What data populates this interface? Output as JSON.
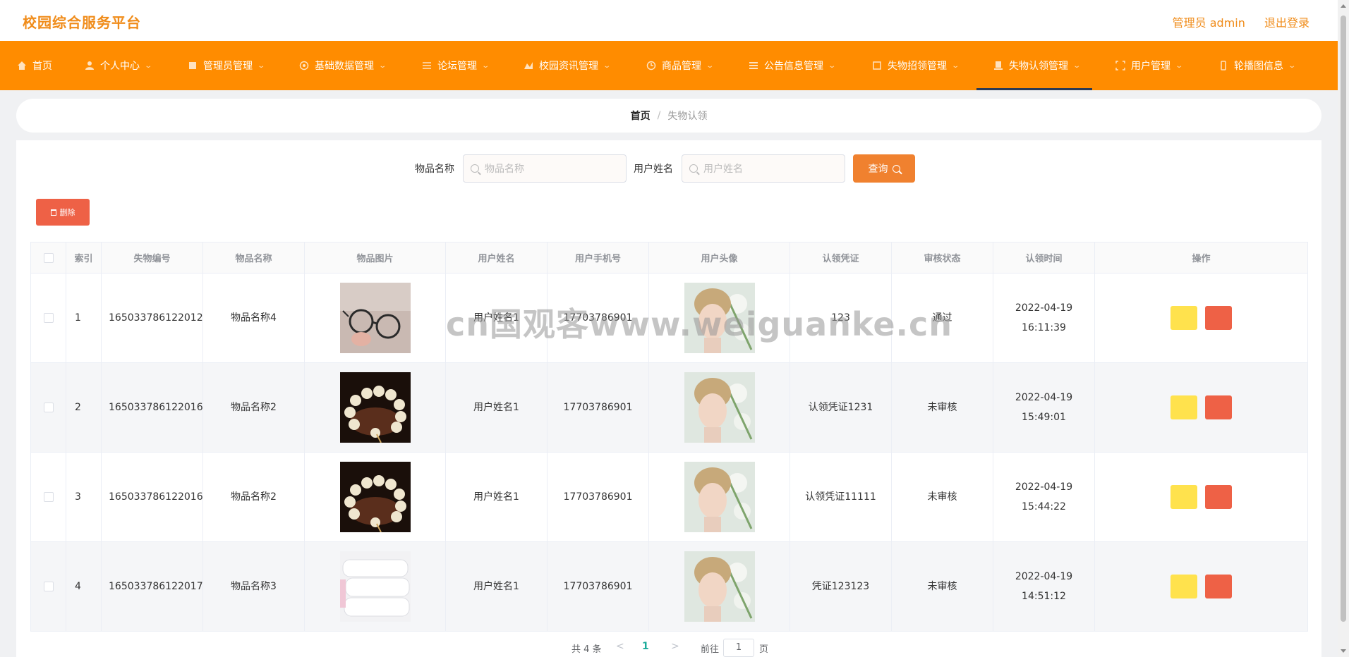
{
  "header": {
    "brand": "校园综合服务平台",
    "admin_label": "管理员 admin",
    "logout_label": "退出登录"
  },
  "nav": {
    "items": [
      {
        "label": "首页",
        "icon": "home-icon",
        "has_menu": false
      },
      {
        "label": "个人中心",
        "icon": "user-icon",
        "has_menu": true
      },
      {
        "label": "管理员管理",
        "icon": "admin-icon",
        "has_menu": true
      },
      {
        "label": "基础数据管理",
        "icon": "data-icon",
        "has_menu": true
      },
      {
        "label": "论坛管理",
        "icon": "forum-icon",
        "has_menu": true
      },
      {
        "label": "校园资讯管理",
        "icon": "news-icon",
        "has_menu": true
      },
      {
        "label": "商品管理",
        "icon": "goods-icon",
        "has_menu": true
      },
      {
        "label": "公告信息管理",
        "icon": "notice-icon",
        "has_menu": true
      },
      {
        "label": "失物招领管理",
        "icon": "lost-found-icon",
        "has_menu": true
      },
      {
        "label": "失物认领管理",
        "icon": "claim-icon",
        "has_menu": true,
        "active": true
      },
      {
        "label": "用户管理",
        "icon": "users-icon",
        "has_menu": true
      },
      {
        "label": "轮播图信息",
        "icon": "carousel-icon",
        "has_menu": true
      }
    ]
  },
  "breadcrumb": {
    "home": "首页",
    "separator": "/",
    "current": "失物认领"
  },
  "search": {
    "item_name_label": "物品名称",
    "item_name_placeholder": "物品名称",
    "user_name_label": "用户姓名",
    "user_name_placeholder": "用户姓名",
    "query_button": "查询"
  },
  "toolbar": {
    "delete_button": "删除"
  },
  "table": {
    "columns": [
      "索引",
      "失物编号",
      "物品名称",
      "物品图片",
      "用户姓名",
      "用户手机号",
      "用户头像",
      "认领凭证",
      "审核状态",
      "认领时间",
      "操作"
    ],
    "rows": [
      {
        "index": "1",
        "number": "165033786122012",
        "item_name": "物品名称4",
        "image": "glasses-photo",
        "user_name": "用户姓名1",
        "phone": "17703786901",
        "avatar": "user-avatar-photo",
        "proof": "123",
        "status": "通过",
        "time": "2022-04-19 16:11:39"
      },
      {
        "index": "2",
        "number": "165033786122016",
        "item_name": "物品名称2",
        "image": "bead-bracelet-photo",
        "user_name": "用户姓名1",
        "phone": "17703786901",
        "avatar": "user-avatar-photo",
        "proof": "认领凭证1231",
        "status": "未审核",
        "time": "2022-04-19 15:49:01"
      },
      {
        "index": "3",
        "number": "165033786122016",
        "item_name": "物品名称2",
        "image": "bead-bracelet-photo",
        "user_name": "用户姓名1",
        "phone": "17703786901",
        "avatar": "user-avatar-photo",
        "proof": "认领凭证11111",
        "status": "未审核",
        "time": "2022-04-19 15:44:22"
      },
      {
        "index": "4",
        "number": "165033786122017",
        "item_name": "物品名称3",
        "image": "towels-photo",
        "user_name": "用户姓名1",
        "phone": "17703786901",
        "avatar": "user-avatar-photo",
        "proof": "凭证123123",
        "status": "未审核",
        "time": "2022-04-19 14:51:12"
      }
    ]
  },
  "pagination": {
    "total": "共 4 条",
    "prev": "<",
    "current_page": "1",
    "next": ">",
    "goto_label": "前往",
    "goto_value": "1",
    "page_suffix": "页"
  },
  "watermark": "cn国观客www.weiguanke.cn",
  "colors": {
    "brand": "#f08c1a",
    "nav_bg": "#ff8c00",
    "query_button": "#f0812f",
    "delete_button": "#ee6146",
    "edit_button": "#ffe24d",
    "active_page": "#1bab9a"
  }
}
